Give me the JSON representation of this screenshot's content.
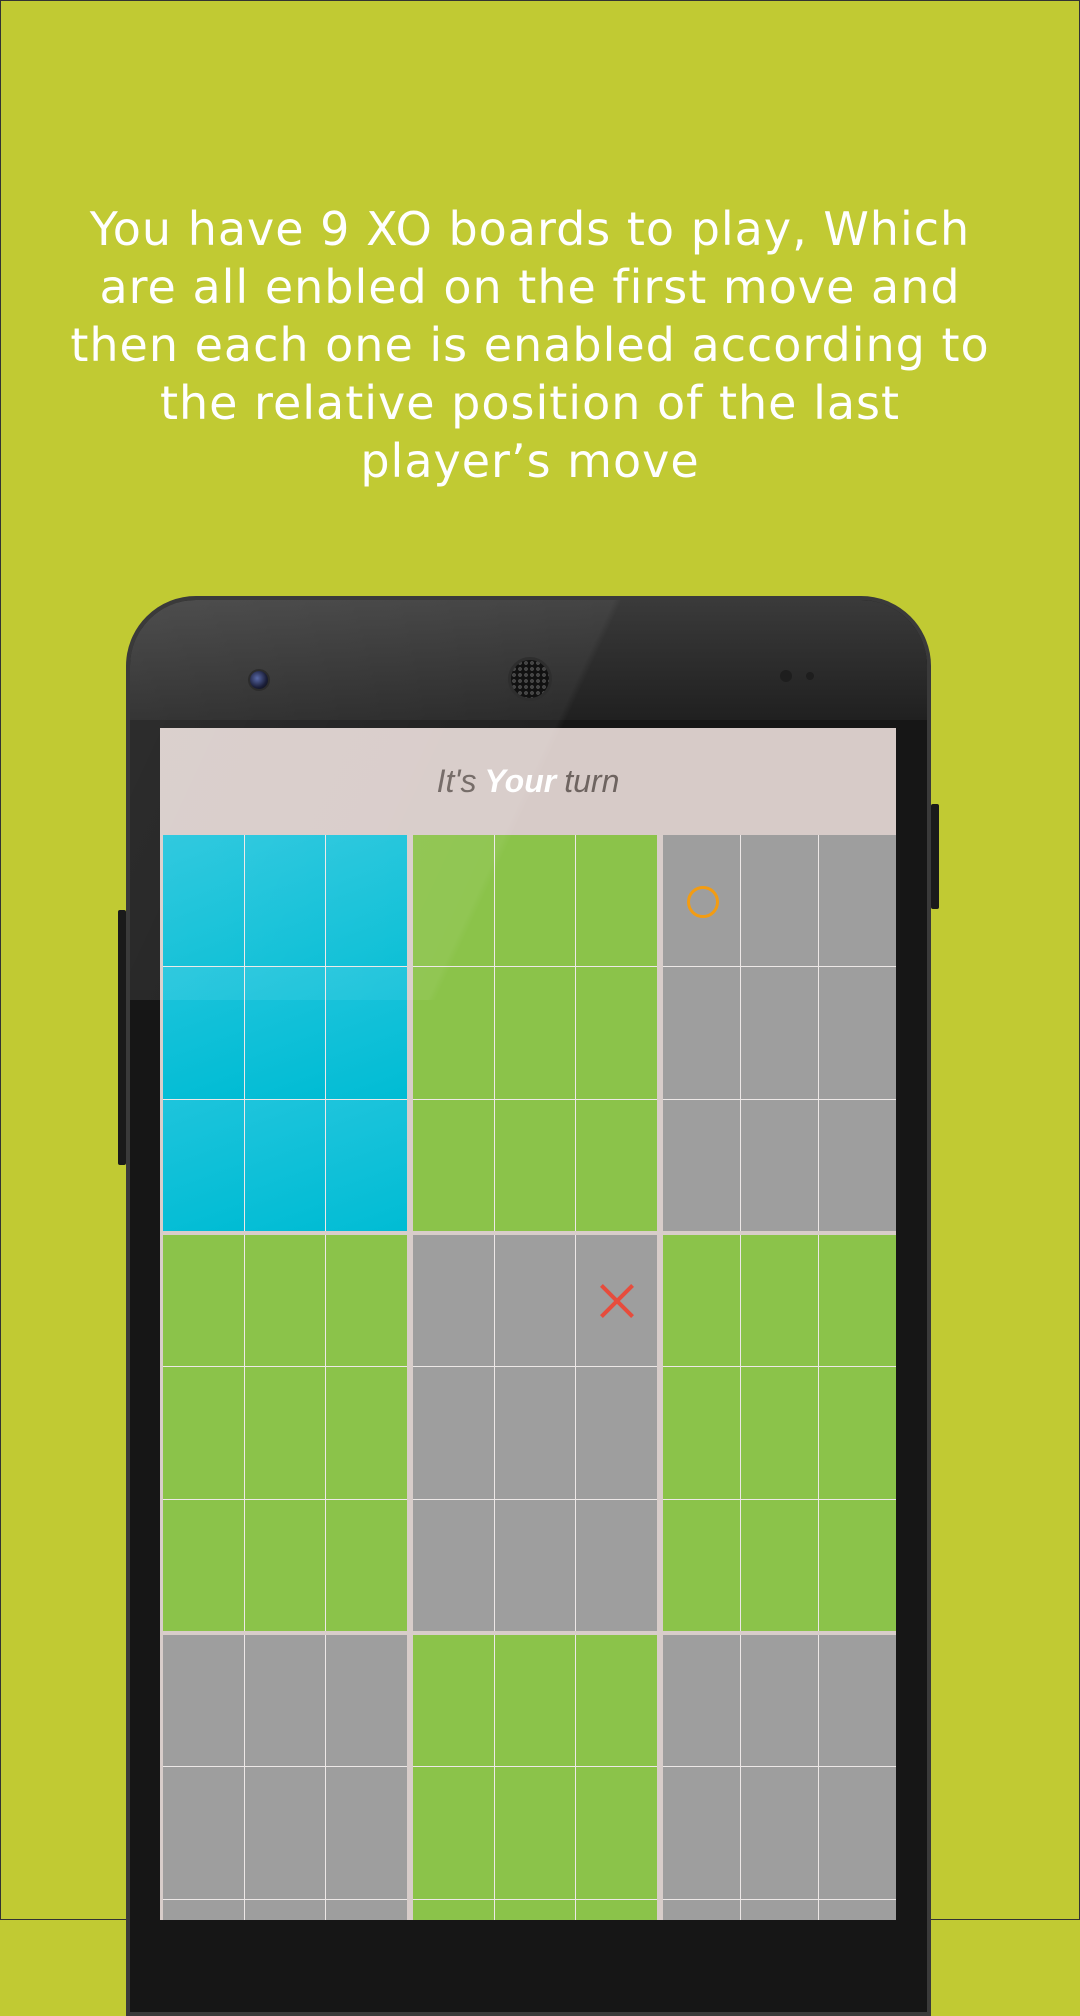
{
  "promo": {
    "description": "You have 9 XO boards to play, Which are all enbled on the first move and then each one is enabled according to the relative position of the last player’s move"
  },
  "status": {
    "prefix": "It's",
    "highlight": "Your",
    "suffix": "turn"
  },
  "colors": {
    "background": "#c1ca33",
    "active_board": "#1bbfd9",
    "enabled_board": "#8bc34a",
    "disabled_board": "#9e9e9e",
    "x_mark": "#e74c3c",
    "o_mark": "#f39c12"
  },
  "boards": [
    {
      "state": "active",
      "cells": [
        "",
        "",
        "",
        "",
        "",
        "",
        "",
        "",
        ""
      ]
    },
    {
      "state": "enabled",
      "cells": [
        "",
        "",
        "",
        "",
        "",
        "",
        "",
        "",
        ""
      ]
    },
    {
      "state": "disabled",
      "cells": [
        "O",
        "",
        "",
        "",
        "",
        "",
        "",
        "",
        ""
      ]
    },
    {
      "state": "enabled",
      "cells": [
        "",
        "",
        "",
        "",
        "",
        "",
        "",
        "",
        ""
      ]
    },
    {
      "state": "disabled",
      "cells": [
        "",
        "",
        "X",
        "",
        "",
        "",
        "",
        "",
        ""
      ]
    },
    {
      "state": "enabled",
      "cells": [
        "",
        "",
        "",
        "",
        "",
        "",
        "",
        "",
        ""
      ]
    },
    {
      "state": "disabled",
      "cells": [
        "",
        "",
        "",
        "",
        "",
        "",
        "",
        "",
        ""
      ]
    },
    {
      "state": "enabled",
      "cells": [
        "",
        "",
        "",
        "",
        "",
        "",
        "",
        "",
        ""
      ]
    },
    {
      "state": "disabled",
      "cells": [
        "",
        "",
        "",
        "",
        "",
        "",
        "",
        "",
        ""
      ]
    }
  ]
}
